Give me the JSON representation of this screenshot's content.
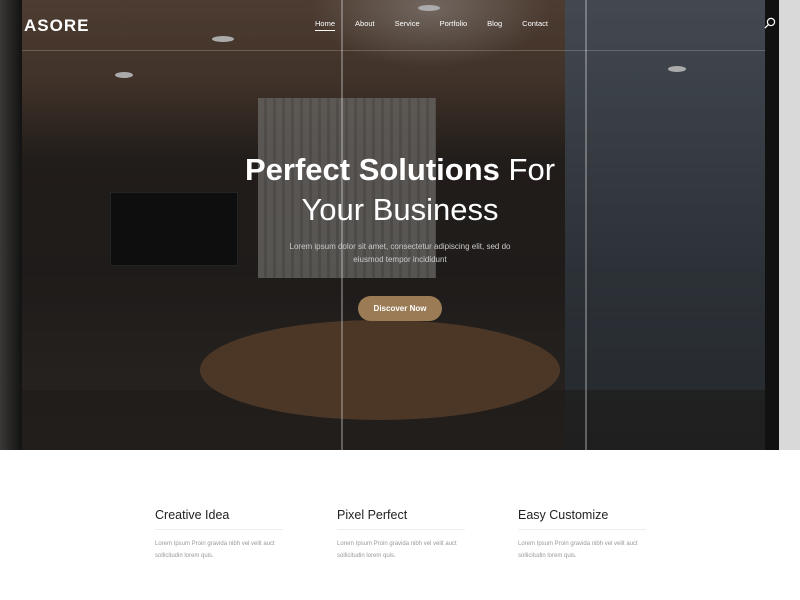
{
  "header": {
    "logo": "ASORE",
    "nav": [
      "Home",
      "About",
      "Service",
      "Portfolio",
      "Blog",
      "Contact"
    ],
    "active": "Home",
    "search_icon": "search-icon"
  },
  "hero": {
    "title_bold": "Perfect Solutions",
    "title_rest": " For",
    "title_line2": "Your Business",
    "subtitle": "Lorem ipsum dolor sit amet, consectetur adipiscing elit, sed do eiusmod tempor incididunt",
    "cta": "Discover Now",
    "accent": "#9b7b55"
  },
  "features": [
    {
      "title": "Creative Idea",
      "text": "Lorem Ipsum Proin gravida nibh vel velit auct sollicitudin lorem quis."
    },
    {
      "title": "Pixel Perfect",
      "text": "Lorem Ipsum Proin gravida nibh vel velit auct sollicitudin lorem quis."
    },
    {
      "title": "Easy Customize",
      "text": "Lorem Ipsum Proin gravida nibh vel velit auct sollicitudin lorem quis."
    }
  ]
}
